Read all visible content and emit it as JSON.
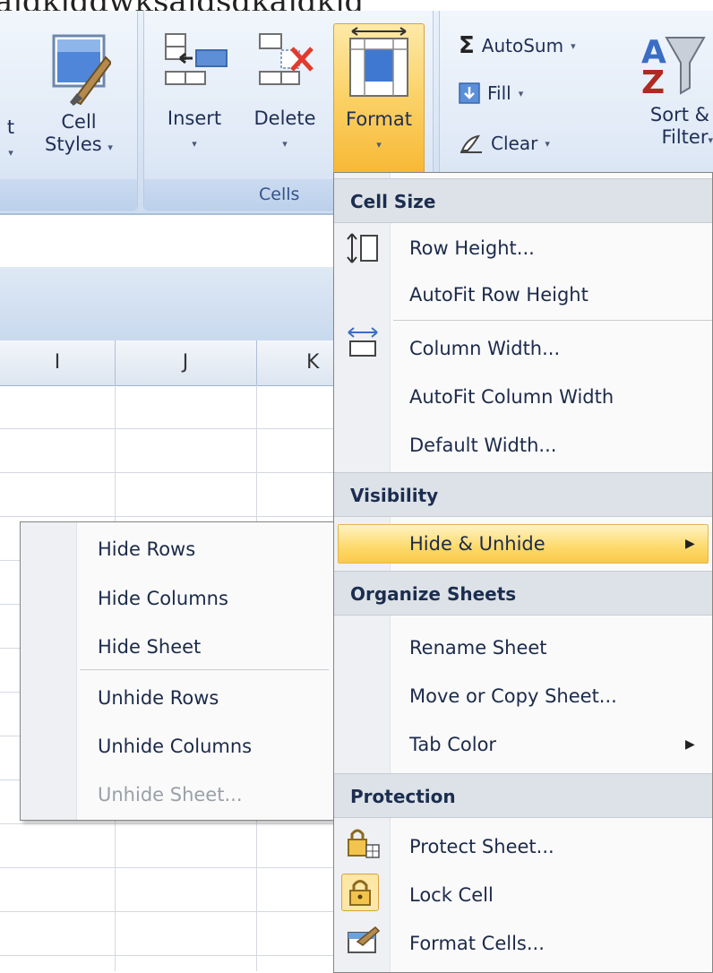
{
  "ribbon": {
    "cell_styles_label_1": "Cell",
    "cell_styles_label_2": "Styles",
    "partial_left_label": "t",
    "insert_label": "Insert",
    "delete_label": "Delete",
    "format_label": "Format",
    "cells_group_label": "Cells",
    "autosum_label": "AutoSum",
    "fill_label": "Fill",
    "clear_label": "Clear",
    "sort_label_1": "Sort &",
    "sort_label_2": "Filter",
    "sigma_glyph": "Σ",
    "dropdown_glyph": "▾"
  },
  "sheet": {
    "columns": [
      "I",
      "J",
      "K"
    ]
  },
  "format_menu": {
    "sections": {
      "cell_size": "Cell Size",
      "visibility": "Visibility",
      "organize": "Organize Sheets",
      "protection": "Protection"
    },
    "items": {
      "row_height": "Row Height...",
      "autofit_row": "AutoFit Row Height",
      "column_width": "Column Width...",
      "autofit_column": "AutoFit Column Width",
      "default_width": "Default Width...",
      "hide_unhide": "Hide & Unhide",
      "rename_sheet": "Rename Sheet",
      "move_copy": "Move or Copy Sheet...",
      "tab_color": "Tab Color",
      "protect_sheet": "Protect Sheet...",
      "lock_cell": "Lock Cell",
      "format_cells": "Format Cells..."
    }
  },
  "hide_submenu": {
    "items": {
      "hide_rows": "Hide Rows",
      "hide_columns": "Hide Columns",
      "hide_sheet": "Hide Sheet",
      "unhide_rows": "Unhide Rows",
      "unhide_columns": "Unhide Columns",
      "unhide_sheet": "Unhide Sheet..."
    }
  },
  "colors": {
    "highlight": "#fdd96a",
    "section_header_bg": "#dde2e8",
    "ribbon_bg": "#dbe7f6",
    "disabled_text": "#9aa0a8"
  }
}
